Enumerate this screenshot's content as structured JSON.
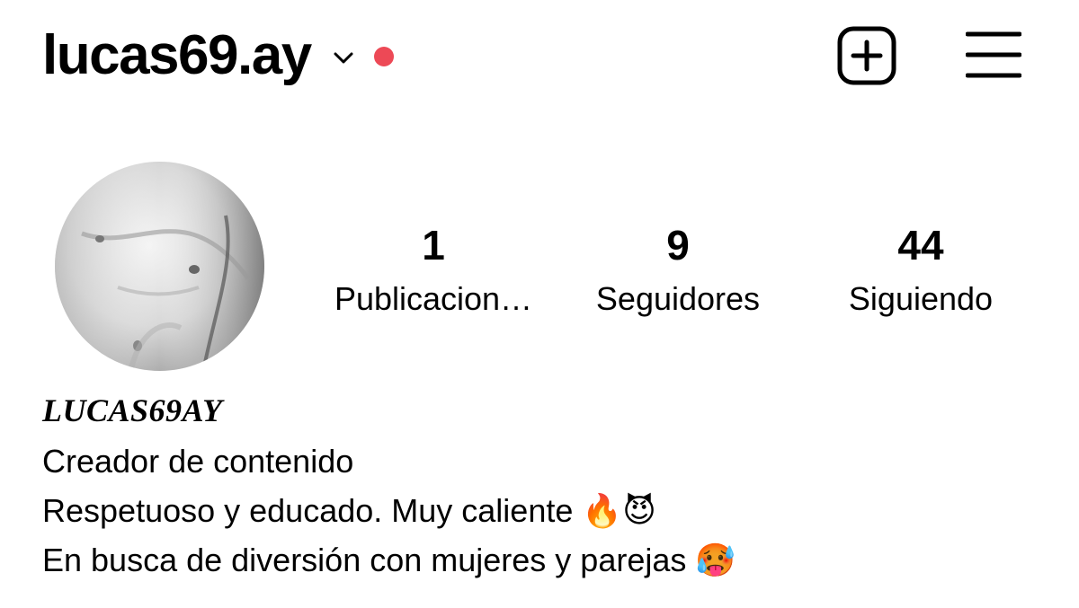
{
  "header": {
    "username": "lucas69.ay",
    "chevron_icon": "chevron-down-icon",
    "notification_dot_color": "#ed4956",
    "add_icon": "plus-square-icon",
    "menu_icon": "hamburger-menu-icon"
  },
  "profile": {
    "avatar_alt": "profile-photo",
    "stats": [
      {
        "value": "1",
        "label": "Publicacion…"
      },
      {
        "value": "9",
        "label": "Seguidores"
      },
      {
        "value": "44",
        "label": "Siguiendo"
      }
    ],
    "display_name": "LUCAS69AY",
    "bio_lines": [
      "Creador de contenido",
      "Respetuoso y educado. Muy caliente 🔥😈",
      "En busca de diversión con mujeres y parejas 🥵"
    ]
  }
}
